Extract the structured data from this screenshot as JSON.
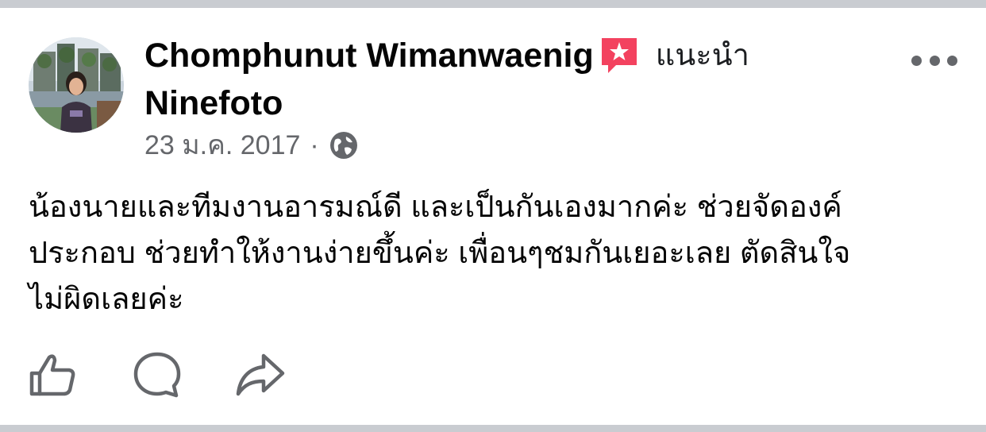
{
  "post": {
    "author_name": "Chomphunut Wimanwaenig",
    "recommend_label": "แนะนำ",
    "page_name": "Ninefoto",
    "date": "23 ม.ค. 2017",
    "separator": "·",
    "body_lines": [
      "น้องนายและทีมงานอารมณ์ดี และเป็นกันเองมากค่ะ ช่วยจัดองค์",
      "ประกอบ ช่วยทำให้งานง่ายขึ้นค่ะ เพื่อนๆชมกันเยอะเลย ตัดสินใจ",
      "ไม่ผิดเลยค่ะ"
    ]
  },
  "icons": {
    "recommend": "recommend-star-icon",
    "audience": "globe-icon",
    "more": "more-options-icon",
    "like": "like-icon",
    "comment": "comment-icon",
    "share": "share-icon"
  },
  "colors": {
    "recommend_badge": "#f3425f",
    "secondary_text": "#65676b",
    "divider": "#c9ccd1"
  }
}
